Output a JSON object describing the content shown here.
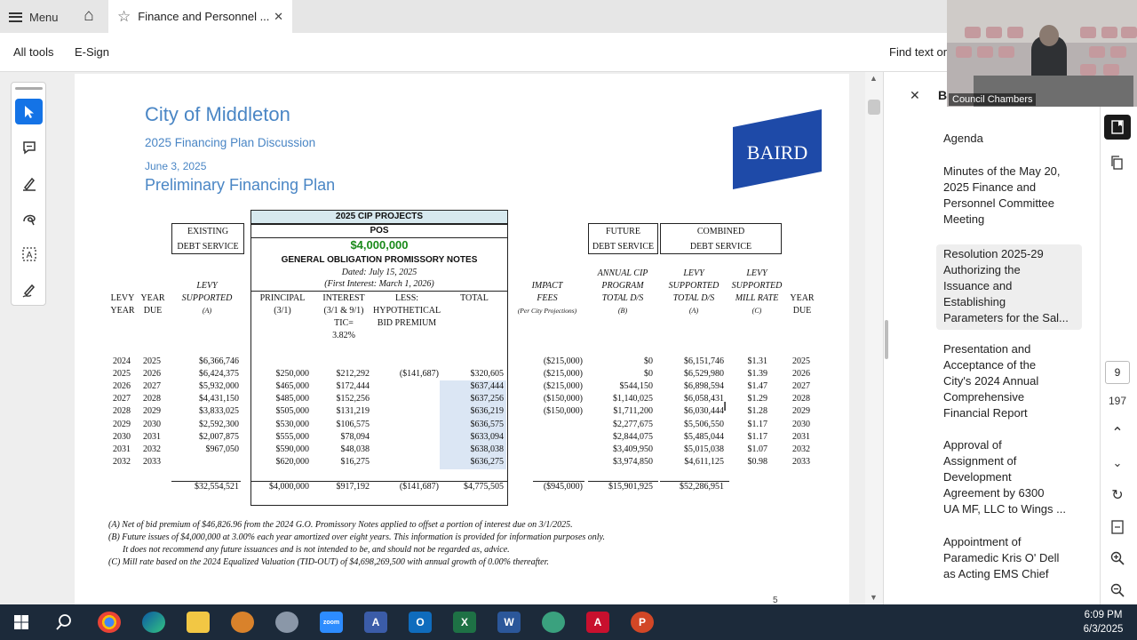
{
  "tab_bar": {
    "menu_label": "Menu",
    "tab_title": "Finance and Personnel ...",
    "close_symbol": "✕"
  },
  "toolbar": {
    "all_tools": "All tools",
    "esign": "E-Sign",
    "find_text": "Find text or"
  },
  "document": {
    "city": "City of Middleton",
    "plan": "2025 Financing Plan Discussion",
    "date": "June 3, 2025",
    "subtitle": "Preliminary Financing Plan",
    "logo_text": "BAIRD",
    "headers": {
      "cip_projects": "2025 CIP PROJECTS",
      "pos": "POS",
      "amount": "$4,000,000",
      "notes": "GENERAL OBLIGATION PROMISSORY NOTES",
      "dated": "Dated: July 15, 2025",
      "first_interest": "(First Interest: March 1, 2026)",
      "existing": [
        "EXISTING",
        "DEBT SERVICE"
      ],
      "future": [
        "FUTURE",
        "DEBT SERVICE"
      ],
      "combined": [
        "COMBINED",
        "DEBT SERVICE"
      ],
      "levy_year": [
        "LEVY",
        "YEAR"
      ],
      "year_due": [
        "YEAR",
        "DUE"
      ],
      "levy_supported": [
        "LEVY",
        "SUPPORTED",
        "(A)"
      ],
      "principal": [
        "PRINCIPAL",
        "(3/1)"
      ],
      "interest": [
        "INTEREST",
        "(3/1 & 9/1)",
        "TIC=",
        "3.82%"
      ],
      "less": [
        "LESS:",
        "HYPOTHETICAL",
        "BID PREMIUM"
      ],
      "total": [
        "TOTAL"
      ],
      "impact_fees": [
        "IMPACT",
        "FEES",
        "(Per City Projections)"
      ],
      "annual_cip": [
        "ANNUAL CIP",
        "PROGRAM",
        "TOTAL D/S",
        "(B)"
      ],
      "levy_total": [
        "LEVY",
        "SUPPORTED",
        "TOTAL D/S",
        "(A)"
      ],
      "mill_rate": [
        "LEVY",
        "SUPPORTED",
        "MILL RATE",
        "(C)"
      ],
      "year_due_right": [
        "YEAR",
        "DUE"
      ]
    },
    "rows": [
      [
        "2024",
        "2025",
        "$6,366,746",
        "",
        "",
        "",
        "",
        "($215,000)",
        "$0",
        "$6,151,746",
        "$1.31",
        "2025"
      ],
      [
        "2025",
        "2026",
        "$6,424,375",
        "$250,000",
        "$212,292",
        "($141,687)",
        "$320,605",
        "($215,000)",
        "$0",
        "$6,529,980",
        "$1.39",
        "2026"
      ],
      [
        "2026",
        "2027",
        "$5,932,000",
        "$465,000",
        "$172,444",
        "",
        "$637,444",
        "($215,000)",
        "$544,150",
        "$6,898,594",
        "$1.47",
        "2027"
      ],
      [
        "2027",
        "2028",
        "$4,431,150",
        "$485,000",
        "$152,256",
        "",
        "$637,256",
        "($150,000)",
        "$1,140,025",
        "$6,058,431",
        "$1.29",
        "2028"
      ],
      [
        "2028",
        "2029",
        "$3,833,025",
        "$505,000",
        "$131,219",
        "",
        "$636,219",
        "($150,000)",
        "$1,711,200",
        "$6,030,444",
        "$1.28",
        "2029"
      ],
      [
        "2029",
        "2030",
        "$2,592,300",
        "$530,000",
        "$106,575",
        "",
        "$636,575",
        "",
        "$2,277,675",
        "$5,506,550",
        "$1.17",
        "2030"
      ],
      [
        "2030",
        "2031",
        "$2,007,875",
        "$555,000",
        "$78,094",
        "",
        "$633,094",
        "",
        "$2,844,075",
        "$5,485,044",
        "$1.17",
        "2031"
      ],
      [
        "2031",
        "2032",
        "$967,050",
        "$590,000",
        "$48,038",
        "",
        "$638,038",
        "",
        "$3,409,950",
        "$5,015,038",
        "$1.07",
        "2032"
      ],
      [
        "2032",
        "2033",
        "",
        "$620,000",
        "$16,275",
        "",
        "$636,275",
        "",
        "$3,974,850",
        "$4,611,125",
        "$0.98",
        "2033"
      ]
    ],
    "totals": [
      "$32,554,521",
      "$4,000,000",
      "$917,192",
      "($141,687)",
      "$4,775,505",
      "($945,000)",
      "$15,901,925",
      "$52,286,951"
    ],
    "footnotes": [
      "(A) Net of bid premium of $46,826.96 from the 2024 G.O. Promissory Notes applied to offset a portion of interest due on 3/1/2025.",
      "(B) Future issues of $4,000,000 at 3.00% each year amortized over eight years. This information is provided for information purposes only.",
      "It does not recommend any future issuances and is not intended to be, and should not be regarded as, advice.",
      "(C) Mill rate based on the 2024 Equalized Valuation (TID-OUT) of $4,698,269,500 with annual growth of 0.00% thereafter."
    ],
    "page_number": "5"
  },
  "right_panel": {
    "title": "B",
    "bookmarks": [
      {
        "lines": [
          "Agenda"
        ]
      },
      {
        "lines": [
          "Minutes of the May 20,",
          "2025 Finance and",
          "Personnel Committee",
          "Meeting"
        ]
      },
      {
        "lines": [
          "Resolution 2025-29",
          "Authorizing the",
          "Issuance and",
          "Establishing",
          "Parameters for the Sal..."
        ]
      },
      {
        "lines": [
          "Presentation and",
          "Acceptance of the",
          "City's 2024 Annual",
          "Comprehensive",
          "Financial Report"
        ]
      },
      {
        "lines": [
          "Approval of",
          "Assignment of",
          "Development",
          "Agreement by 6300",
          "UA MF, LLC to Wings ..."
        ]
      },
      {
        "lines": [
          "Appointment of",
          "Paramedic Kris O' Dell",
          "as Acting EMS Chief"
        ]
      }
    ]
  },
  "page_nav": {
    "current": "9",
    "total": "197"
  },
  "webcam": {
    "label": "Council Chambers"
  },
  "taskbar": {
    "time": "6:09 PM",
    "date": "6/3/2025"
  },
  "colors": {
    "accent": "#1473e6",
    "title_blue": "#4a86c5",
    "baird_blue": "#1e4aa8",
    "green": "#1a8a1a",
    "highlight": "#dbe6f4"
  }
}
